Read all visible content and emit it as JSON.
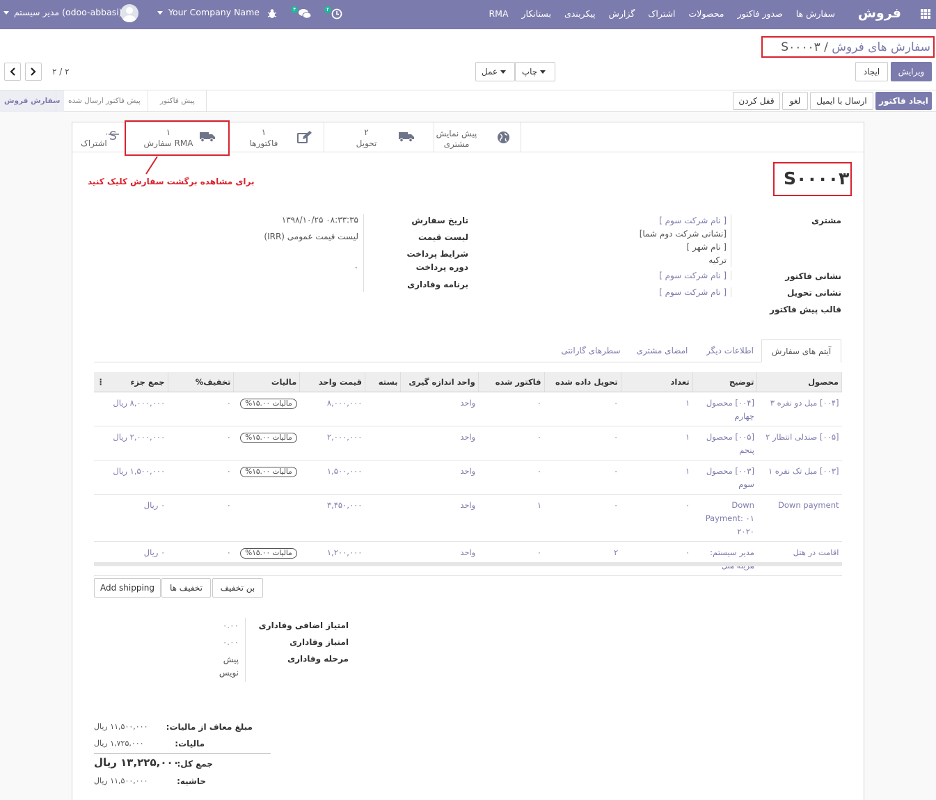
{
  "topnav": {
    "brand": "فروش",
    "menu": [
      "سفارش ها",
      "صدور فاکتور",
      "محصولات",
      "اشتراک",
      "گزارش",
      "پیکربندی",
      "بستانکار",
      "RMA"
    ],
    "company": "Your Company Name",
    "user": "مدیر سیستم (odoo-abbasi)",
    "messages_count": "۴",
    "activities_count": "۲"
  },
  "control": {
    "breadcrumb_parent": "سفارش های فروش",
    "breadcrumb_current": "S۰۰۰۰۳",
    "edit_label": "ویرایش",
    "create_label": "ایجاد",
    "print_label": "چاپ",
    "action_label": "عمل",
    "pager": "۲ / ۲"
  },
  "statusbar": {
    "buttons": [
      "ایجاد فاکتور",
      "ارسال با ایمیل",
      "لغو",
      "قفل کردن"
    ],
    "stages": [
      "سفارش فروش",
      "پیش فاکتور ارسال شده",
      "پیش فاکتور"
    ],
    "active_stage": "سفارش فروش"
  },
  "smart_buttons": [
    {
      "value": "",
      "label": "پیش نمایش مشتری",
      "icon": "globe-icon"
    },
    {
      "value": "۲",
      "label": "تحویل",
      "icon": "truck-icon"
    },
    {
      "value": "۱",
      "label": "فاکتورها",
      "icon": "pencil-square-icon"
    },
    {
      "value": "۱",
      "label": "سفارش RMA",
      "icon": "truck-icon"
    },
    {
      "value": "۰",
      "label": "اشتراک",
      "icon": "subscription-icon"
    }
  ],
  "annotation": "برای مشاهده برگشت سفارش کلیک کنید",
  "order": {
    "name": "S۰۰۰۰۳",
    "customer_label": "مشتری",
    "customer_lines": [
      "[ نام شرکت سوم ]",
      "[نشانی شرکت دوم شما]",
      "[ نام شهر ]",
      "ترکیه"
    ],
    "invoice_address_label": "نشانی فاکتور",
    "invoice_address": "[ نام شرکت سوم ]",
    "delivery_address_label": "نشانی تحویل",
    "delivery_address": "[ نام شرکت سوم ]",
    "quote_template_label": "قالب پیش فاکتور",
    "order_date_label": "تاریخ سفارش",
    "order_date": "۱۳۹۸/۱۰/۲۵ ۰۸:۳۳:۳۵",
    "pricelist_label": "لیست قیمت",
    "pricelist": "لیست قیمت عمومی (IRR)",
    "payment_terms_label": "شرایط پرداخت",
    "payment_period_label": "دوره پرداخت",
    "payment_period": "۰",
    "loyalty_label": "برنامه وفاداری"
  },
  "tabs": [
    "آیتم های سفارش",
    "اطلاعات دیگر",
    "امضای مشتری",
    "سطرهای گارانتی"
  ],
  "table": {
    "headers": [
      "محصول",
      "توضیح",
      "تعداد",
      "تحویل داده شده",
      "فاکتور شده",
      "واحد اندازه گیری",
      "بسته",
      "قیمت واحد",
      "مالیات",
      "تخفیف%",
      "جمع جزء"
    ],
    "rows": [
      {
        "product": "[۰۰۴] مبل دو نفره ۳",
        "desc": "[۰۰۴] محصول چهارم",
        "qty": "۱",
        "delivered": "۰",
        "invoiced": "۰",
        "uom": "واحد",
        "package": "",
        "price": "۸,۰۰۰,۰۰۰",
        "tax": "مالیات ۱۵.۰۰%",
        "discount": "۰",
        "subtotal": "۸,۰۰۰,۰۰۰ ریال"
      },
      {
        "product": "[۰۰۵] صندلی انتظار ۲",
        "desc": "[۰۰۵] محصول پنجم",
        "qty": "۱",
        "delivered": "۰",
        "invoiced": "۰",
        "uom": "واحد",
        "package": "",
        "price": "۲,۰۰۰,۰۰۰",
        "tax": "مالیات ۱۵.۰۰%",
        "discount": "۰",
        "subtotal": "۲,۰۰۰,۰۰۰ ریال"
      },
      {
        "product": "[۰۰۳] مبل تک نفره ۱",
        "desc": "[۰۰۳] محصول سوم",
        "qty": "۱",
        "delivered": "۰",
        "invoiced": "۰",
        "uom": "واحد",
        "package": "",
        "price": "۱,۵۰۰,۰۰۰",
        "tax": "مالیات ۱۵.۰۰%",
        "discount": "۰",
        "subtotal": "۱,۵۰۰,۰۰۰ ریال"
      },
      {
        "product": "Down payment",
        "desc": "Down Payment: ۰۱ ۲۰۲۰",
        "qty": "۰",
        "delivered": "۰",
        "invoiced": "۱",
        "uom": "واحد",
        "package": "",
        "price": "۳,۴۵۰,۰۰۰",
        "tax": "",
        "discount": "۰",
        "subtotal": "۰ ریال"
      },
      {
        "product": "اقامت در هتل",
        "desc": "مدیر سیستم: هزینه هتل",
        "qty": "۰",
        "delivered": "۲",
        "invoiced": "۰",
        "uom": "واحد",
        "package": "",
        "price": "۱,۲۰۰,۰۰۰",
        "tax": "مالیات ۱۵.۰۰%",
        "discount": "۰",
        "subtotal": "۰ ریال"
      }
    ]
  },
  "actions": [
    "بن تخفیف",
    "تخفیف ها",
    "Add shipping"
  ],
  "loyalty": {
    "extra_points_label": "امتیاز اضافی وفاداری",
    "extra_points": "۰.۰۰",
    "points_label": "امتیاز وفاداری",
    "points": "۰.۰۰",
    "level_label": "مرحله وفاداری",
    "level": "پیش نویس"
  },
  "totals": {
    "untaxed_label": "مبلغ معاف از مالیات:",
    "untaxed": "۱۱,۵۰۰,۰۰۰ ریال",
    "tax_label": "مالیات:",
    "tax": "۱,۷۲۵,۰۰۰ ریال",
    "total_label": "جمع کل:",
    "total": "۱۳,۲۲۵,۰۰۰ ریال",
    "margin_label": "حاشیه:",
    "margin": "۱۱,۵۰۰,۰۰۰ ریال"
  },
  "colors": {
    "brand": "#7c7bad",
    "highlight": "#d9232d",
    "badge": "#21b799"
  }
}
